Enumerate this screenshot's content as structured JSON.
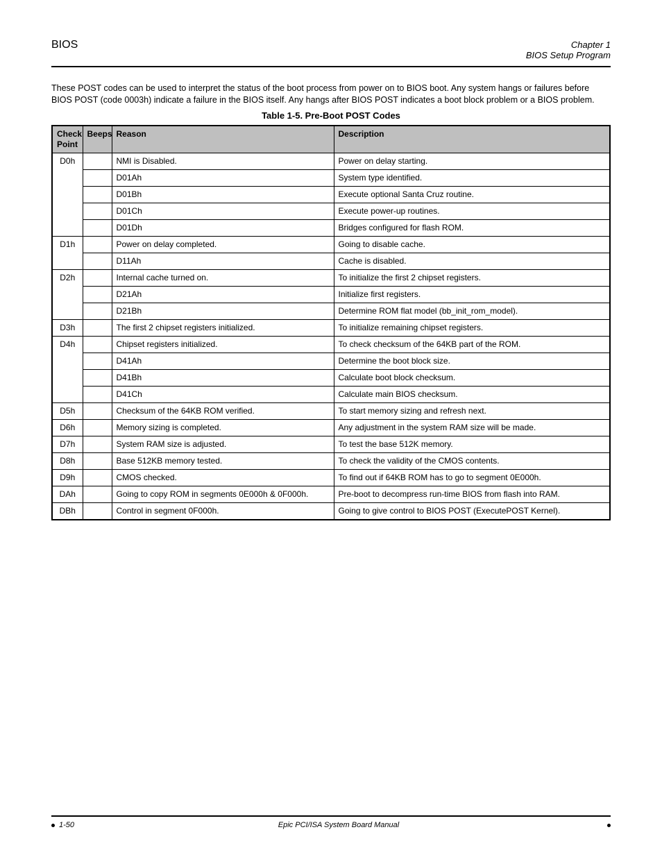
{
  "header": {
    "left": "BIOS",
    "right_line1": "Chapter 1",
    "right_line2": "BIOS Setup Program"
  },
  "intro": "These POST codes can be used to interpret the status of the boot process from power on to BIOS boot. Any system hangs or failures before BIOS POST (code 0003h) indicate a failure in the BIOS itself. Any hangs after BIOS POST indicates a boot block problem or a BIOS problem.",
  "table_title": "Table 1-5. Pre-Boot POST Codes",
  "columns": {
    "checkpoint": "Check Point",
    "beeps": "Beeps",
    "reason": "Reason",
    "description": "Description"
  },
  "rows": [
    {
      "group_first": true,
      "cp": "D0h",
      "cp_rowspan": 5,
      "beep": "",
      "reason": "NMI is Disabled.",
      "description": "Power on delay starting."
    },
    {
      "cp_skip": true,
      "beep": "",
      "reason": "D01Ah",
      "description": "System type identified."
    },
    {
      "cp_skip": true,
      "beep": "",
      "reason": "D01Bh",
      "description": "Execute optional Santa Cruz routine."
    },
    {
      "cp_skip": true,
      "beep": "",
      "reason": "D01Ch",
      "description": "Execute power-up routines."
    },
    {
      "cp_skip": true,
      "beep": "",
      "reason": "D01Dh",
      "description": "Bridges configured for flash ROM."
    },
    {
      "group_first": true,
      "cp": "D1h",
      "cp_rowspan": 2,
      "beep": "",
      "reason": "Power on delay completed.",
      "description": "Going to disable cache."
    },
    {
      "cp_skip": true,
      "beep": "",
      "reason": "D11Ah",
      "description": "Cache is disabled."
    },
    {
      "group_first": true,
      "cp": "D2h",
      "cp_rowspan": 3,
      "beep": "",
      "reason": "Internal cache turned on.",
      "description": "To initialize the first 2 chipset registers."
    },
    {
      "cp_skip": true,
      "beep": "",
      "reason": "D21Ah",
      "description": "Initialize first registers."
    },
    {
      "cp_skip": true,
      "beep": "",
      "reason": "D21Bh",
      "description": "Determine ROM flat model (bb_init_rom_model)."
    },
    {
      "group_first": true,
      "cp": "D3h",
      "cp_rowspan": 1,
      "beep": "",
      "reason": "The first 2 chipset registers initialized.",
      "description": "To initialize remaining chipset registers."
    },
    {
      "group_first": true,
      "cp": "D4h",
      "cp_rowspan": 4,
      "beep": "",
      "reason": "Chipset registers initialized.",
      "description": "To check checksum of the 64KB part of the ROM."
    },
    {
      "cp_skip": true,
      "beep": "",
      "reason": "D41Ah",
      "description": "Determine the boot block size."
    },
    {
      "cp_skip": true,
      "beep": "",
      "reason": "D41Bh",
      "description": "Calculate boot block checksum."
    },
    {
      "cp_skip": true,
      "beep": "",
      "reason": "D41Ch",
      "description": "Calculate main BIOS checksum."
    },
    {
      "group_first": true,
      "cp": "D5h",
      "cp_rowspan": 1,
      "beep": "",
      "reason": "Checksum of the 64KB ROM verified.",
      "description": "To start memory sizing and refresh next."
    },
    {
      "group_first": true,
      "cp": "D6h",
      "cp_rowspan": 1,
      "beep": "",
      "reason": "Memory sizing is completed.",
      "description": "Any adjustment in the system RAM size will be made."
    },
    {
      "group_first": true,
      "cp": "D7h",
      "cp_rowspan": 1,
      "beep": "",
      "reason": "System RAM size is adjusted.",
      "description": "To test the base 512K memory."
    },
    {
      "group_first": true,
      "cp": "D8h",
      "cp_rowspan": 1,
      "beep": "",
      "reason": "Base 512KB memory tested.",
      "description": "To check the validity of the CMOS contents."
    },
    {
      "group_first": true,
      "cp": "D9h",
      "cp_rowspan": 1,
      "beep": "",
      "reason": "CMOS checked.",
      "description": "To find out if 64KB ROM has to go to segment 0E000h."
    },
    {
      "group_first": true,
      "cp": "DAh",
      "cp_rowspan": 1,
      "beep": "",
      "reason": "Going to copy ROM in segments 0E000h & 0F000h.",
      "description": "Pre-boot to decompress run-time BIOS from flash into RAM."
    },
    {
      "group_first": true,
      "cp": "DBh",
      "cp_rowspan": 1,
      "beep": "",
      "reason": "Control in segment 0F000h.",
      "description": "Going to give control to BIOS POST (ExecutePOST Kernel)."
    }
  ],
  "footer": {
    "left": "1-50",
    "center": "Epic PCI/ISA System Board Manual",
    "right": ""
  }
}
